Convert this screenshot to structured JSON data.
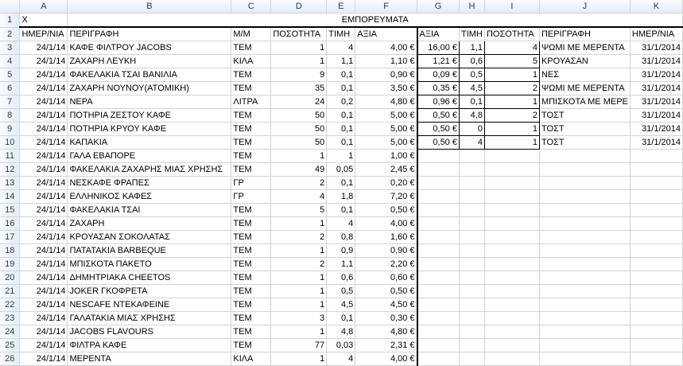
{
  "columns": [
    "A",
    "B",
    "C",
    "D",
    "E",
    "F",
    "G",
    "H",
    "I",
    "J",
    "K"
  ],
  "title_row": {
    "x": "X",
    "title": "ΕΜΠΟΡΕΥΜΑΤΑ"
  },
  "header_row": {
    "A": "ΗΜΕΡ/ΝΙΑ",
    "B": "ΠΕΡΙΓΡΑΦΗ",
    "C": "Μ/Μ",
    "D": "ΠΟΣΟΤΗΤΑ",
    "E": "ΤΙΜΗ",
    "F": "ΑΞΙΑ",
    "G": "ΑΞΙΑ",
    "H": "ΤΙΜΗ",
    "I": "ΠΟΣΟΤΗΤΑ",
    "J": "ΠΕΡΙΓΡΑΦΗ",
    "K": "ΗΜΕΡ/ΝΙΑ"
  },
  "rows": [
    {
      "n": "3",
      "A": "24/1/14",
      "B": "ΚΑΦΕ ΦΙΛΤΡΟΥ JACOBS",
      "C": "ΤΕΜ",
      "D": "1",
      "E": "4",
      "F": "4,00 €",
      "G": "16,00 €",
      "H": "1,1",
      "I": "4",
      "J": "ΨΩΜΙ ΜΕ ΜΕΡΕΝΤΑ",
      "K": "31/1/2014"
    },
    {
      "n": "4",
      "A": "24/1/14",
      "B": "ΖΑΧΑΡΗ ΛΕΥΚΗ",
      "C": "ΚΙΛΑ",
      "D": "1",
      "E": "1,1",
      "F": "1,10 €",
      "G": "1,21 €",
      "H": "0,6",
      "I": "5",
      "J": "ΚΡΟΥΑΣΑΝ",
      "K": "31/1/2014"
    },
    {
      "n": "5",
      "A": "24/1/14",
      "B": "ΦΑΚΕΛΑΚΙΑ ΤΣΑΙ ΒΑΝΙΛΙΑ",
      "C": "ΤΕΜ",
      "D": "9",
      "E": "0,1",
      "F": "0,90 €",
      "G": "0,09 €",
      "H": "0,5",
      "I": "1",
      "J": "ΝΕΣ",
      "K": "31/1/2014"
    },
    {
      "n": "6",
      "A": "24/1/14",
      "B": "ΖΑΧΑΡΗ ΝΟΥΝΟΥ(ΑΤΟΜΙΚΗ)",
      "C": "ΤΕΜ",
      "D": "35",
      "E": "0,1",
      "F": "3,50 €",
      "G": "0,35 €",
      "H": "4,5",
      "I": "2",
      "J": "ΨΩΜΙ ΜΕ ΜΕΡΕΝΤΑ",
      "K": "31/1/2014"
    },
    {
      "n": "7",
      "A": "24/1/14",
      "B": "ΝΕΡΑ",
      "C": "ΛΙΤΡΑ",
      "D": "24",
      "E": "0,2",
      "F": "4,80 €",
      "G": "0,96 €",
      "H": "0,1",
      "I": "1",
      "J": "ΜΠΙΣΚΟΤΑ ΜΕ ΜΕΡΕ",
      "K": "31/1/2014"
    },
    {
      "n": "8",
      "A": "24/1/14",
      "B": "ΠΟΤΗΡΙΑ ΖΕΣΤΟΥ ΚΑΦΕ",
      "C": "ΤΕΜ",
      "D": "50",
      "E": "0,1",
      "F": "5,00 €",
      "G": "0,50 €",
      "H": "4,8",
      "I": "2",
      "J": "ΤΟΣΤ",
      "K": "31/1/2014"
    },
    {
      "n": "9",
      "A": "24/1/14",
      "B": "ΠΟΤΗΡΙΑ ΚΡΥΟΥ ΚΑΦΕ",
      "C": "ΤΕΜ",
      "D": "50",
      "E": "0,1",
      "F": "5,00 €",
      "G": "0,50 €",
      "H": "0",
      "I": "1",
      "J": "ΤΟΣΤ",
      "K": "31/1/2014"
    },
    {
      "n": "10",
      "A": "24/1/14",
      "B": "ΚΑΠΑΚΙΑ",
      "C": "ΤΕΜ",
      "D": "50",
      "E": "0,1",
      "F": "5,00 €",
      "G": "0,50 €",
      "H": "4",
      "I": "1",
      "J": "ΤΟΣΤ",
      "K": "31/1/2014"
    },
    {
      "n": "11",
      "A": "24/1/14",
      "B": "ΓΑΛΑ ΕΒΑΠΟΡΕ",
      "C": "ΤΕΜ",
      "D": "1",
      "E": "1",
      "F": "1,00 €",
      "G": "",
      "H": "",
      "I": "",
      "J": "",
      "K": ""
    },
    {
      "n": "12",
      "A": "24/1/14",
      "B": "ΦΑΚΕΛΑΚΙΑ ΖΑΧΑΡΗΣ ΜΙΑΣ ΧΡΗΣΗΣ",
      "C": "ΤΕΜ",
      "D": "49",
      "E": "0,05",
      "F": "2,45 €",
      "G": "",
      "H": "",
      "I": "",
      "J": "",
      "K": ""
    },
    {
      "n": "13",
      "A": "24/1/14",
      "B": "ΝΕΣΚΑΦΕ ΦΡΑΠΕΣ",
      "C": "ΓΡ",
      "D": "2",
      "E": "0,1",
      "F": "0,20 €",
      "G": "",
      "H": "",
      "I": "",
      "J": "",
      "K": ""
    },
    {
      "n": "14",
      "A": "24/1/14",
      "B": "ΕΛΛΗΝΙΚΟΣ ΚΑΦΕΣ",
      "C": "ΓΡ",
      "D": "4",
      "E": "1,8",
      "F": "7,20 €",
      "G": "",
      "H": "",
      "I": "",
      "J": "",
      "K": ""
    },
    {
      "n": "15",
      "A": "24/1/14",
      "B": "ΦΑΚΕΛΑΚΙΑ ΤΣΑΙ",
      "C": "ΤΕΜ",
      "D": "5",
      "E": "0,1",
      "F": "0,50 €",
      "G": "",
      "H": "",
      "I": "",
      "J": "",
      "K": ""
    },
    {
      "n": "16",
      "A": "24/1/14",
      "B": "ΖΑΧΑΡΗ",
      "C": "ΤΕΜ",
      "D": "1",
      "E": "4",
      "F": "4,00 €",
      "G": "",
      "H": "",
      "I": "",
      "J": "",
      "K": ""
    },
    {
      "n": "17",
      "A": "24/1/14",
      "B": "ΚΡΟΥΑΣΑΝ ΣΟΚΟΛΑΤΑΣ",
      "C": "ΤΕΜ",
      "D": "2",
      "E": "0,8",
      "F": "1,60 €",
      "G": "",
      "H": "",
      "I": "",
      "J": "",
      "K": ""
    },
    {
      "n": "18",
      "A": "24/1/14",
      "B": "ΠΑΤΑΤΑΚΙΑ BARBEQUE",
      "C": "ΤΕΜ",
      "D": "1",
      "E": "0,9",
      "F": "0,90 €",
      "G": "",
      "H": "",
      "I": "",
      "J": "",
      "K": ""
    },
    {
      "n": "19",
      "A": "24/1/14",
      "B": "ΜΠΙΣΚΟΤΑ ΠΑΚΕΤΟ",
      "C": "ΤΕΜ",
      "D": "2",
      "E": "1,1",
      "F": "2,20 €",
      "G": "",
      "H": "",
      "I": "",
      "J": "",
      "K": ""
    },
    {
      "n": "20",
      "A": "24/1/14",
      "B": "ΔΗΜΗΤΡΙΑΚΑ CHEETOS",
      "C": "ΤΕΜ",
      "D": "1",
      "E": "0,6",
      "F": "0,60 €",
      "G": "",
      "H": "",
      "I": "",
      "J": "",
      "K": ""
    },
    {
      "n": "21",
      "A": "24/1/14",
      "B": "JOKER ΓΚΟΦΡΕΤΑ",
      "C": "ΤΕΜ",
      "D": "1",
      "E": "0,5",
      "F": "0,50 €",
      "G": "",
      "H": "",
      "I": "",
      "J": "",
      "K": ""
    },
    {
      "n": "22",
      "A": "24/1/14",
      "B": "NESCAFE ΝΤΕΚΑΦΕΙΝΕ",
      "C": "ΤΕΜ",
      "D": "1",
      "E": "4,5",
      "F": "4,50 €",
      "G": "",
      "H": "",
      "I": "",
      "J": "",
      "K": ""
    },
    {
      "n": "23",
      "A": "24/1/14",
      "B": "ΓΑΛΑΤΑΚΙΑ ΜΙΑΣ ΧΡΗΣΗΣ",
      "C": "ΤΕΜ",
      "D": "3",
      "E": "0,1",
      "F": "0,30 €",
      "G": "",
      "H": "",
      "I": "",
      "J": "",
      "K": ""
    },
    {
      "n": "24",
      "A": "24/1/14",
      "B": "JACOBS FLAVOURS",
      "C": "ΤΕΜ",
      "D": "1",
      "E": "4,8",
      "F": "4,80 €",
      "G": "",
      "H": "",
      "I": "",
      "J": "",
      "K": ""
    },
    {
      "n": "25",
      "A": "24/1/14",
      "B": "ΦΙΛΤΡΑ ΚΑΦΕ",
      "C": "ΤΕΜ",
      "D": "77",
      "E": "0,03",
      "F": "2,31 €",
      "G": "",
      "H": "",
      "I": "",
      "J": "",
      "K": ""
    },
    {
      "n": "26",
      "A": "24/1/14",
      "B": "ΜΕΡΕΝΤΑ",
      "C": "ΚΙΛΑ",
      "D": "1",
      "E": "4",
      "F": "4,00 €",
      "G": "",
      "H": "",
      "I": "",
      "J": "",
      "K": ""
    }
  ]
}
